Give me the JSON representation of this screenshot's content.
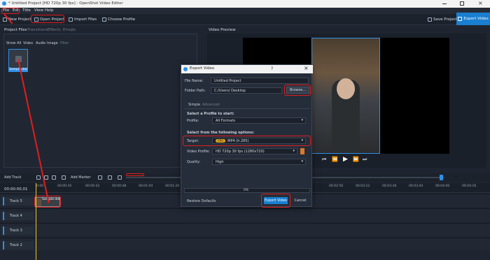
{
  "window": {
    "title": "* Untitled Project [HD 720p 30 fps] - OpenShot Video Editor"
  },
  "menu": {
    "items": [
      "File",
      "Edit",
      "Title",
      "View",
      "Help"
    ]
  },
  "toolbar": {
    "new_project": "New Project",
    "open_project": "Open Project",
    "import_files": "Import Files",
    "choose_profile": "Choose Profile",
    "save_project": "Save Project",
    "export_video": "Export Video"
  },
  "project_files": {
    "tabs": [
      "Project Files",
      "Transitions",
      "Effects",
      "Emojis"
    ],
    "filters": [
      "Show All",
      "Video",
      "Audio",
      "Image",
      "Filter"
    ],
    "thumb_label": "Sample.dat"
  },
  "video_preview": {
    "title": "Video Preview"
  },
  "timeline": {
    "add_track": "Add Track",
    "add_marker": "Add Marker",
    "current_time": "00:00:00,01",
    "ruler": [
      "0:00",
      "00:00:16",
      "00:00:32",
      "00:00:48",
      "00:01:04",
      "00:01:20",
      "00:02:56",
      "00:03:12",
      "00:03:28",
      "00:03:44",
      "00:04:00",
      "00:04:16"
    ],
    "tracks": [
      "Track 5",
      "Track 4",
      "Track 3",
      "Track 2"
    ],
    "clip_label": "Sample.dat"
  },
  "export_dialog": {
    "title": "Export Video",
    "help": "?",
    "file_name_label": "File Name:",
    "file_name_value": "Untitled Project",
    "folder_path_label": "Folder Path:",
    "folder_path_value": "C:/Users/        Desktop",
    "browse": "Browse...",
    "tab_simple": "Simple",
    "tab_advanced": "Advanced",
    "profile_heading": "Select a Profile to start:",
    "profile_label": "Profile:",
    "profile_value": "All Formats",
    "options_heading": "Select from the following options:",
    "target_label": "Target:",
    "target_badge": "CPU",
    "target_value": "MP4 (h.265)",
    "video_profile_label": "Video Profile:",
    "video_profile_value": "HD 720p 30 fps (1280x720)",
    "quality_label": "Quality:",
    "quality_value": "High",
    "progress": "0%",
    "restore_defaults": "Restore Defaults",
    "export_button": "Export Video",
    "cancel_button": "Cancel"
  }
}
